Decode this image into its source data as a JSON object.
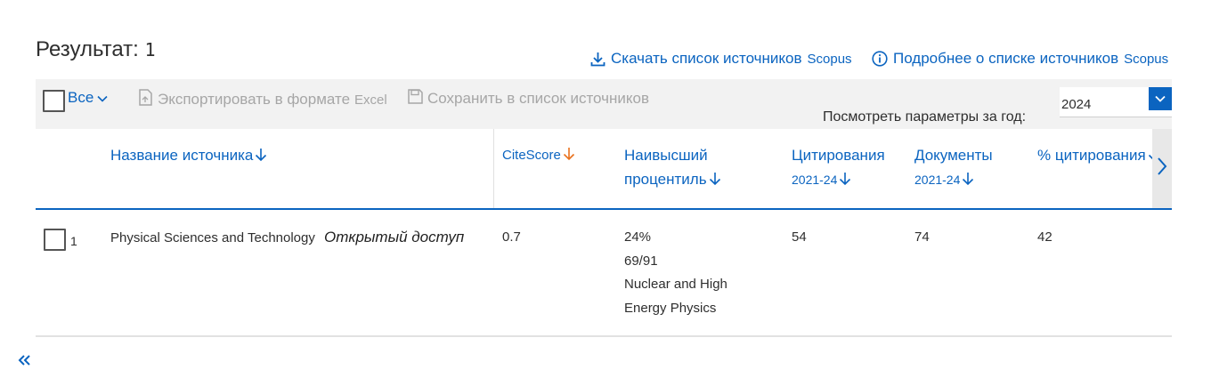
{
  "header": {
    "results_label": "Результат:",
    "results_count": "1",
    "download_link": {
      "text": "Скачать список источников",
      "suffix": "Scopus"
    },
    "info_link": {
      "text": "Подробнее о списке источников",
      "suffix": "Scopus"
    }
  },
  "toolbar": {
    "all_label": "Все",
    "export_label": "Экспортировать в формате",
    "export_suffix": "Excel",
    "save_label": "Сохранить в список источников",
    "year_label": "Посмотреть параметры за год:",
    "year_value": "2024"
  },
  "table": {
    "columns": {
      "source_title": "Название источника",
      "citescore": "CiteScore",
      "percentile_line1": "Наивысший",
      "percentile_line2": "процентиль",
      "citations": "Цитирования",
      "citations_range": "2021-24",
      "documents": "Документы",
      "documents_range": "2021-24",
      "percent_cited": "% цитирования"
    },
    "rows": [
      {
        "index": "1",
        "source_title": "Physical Sciences and Technology",
        "open_access": "Открытый доступ",
        "citescore": "0.7",
        "percentile": "24%",
        "rank": "69/91",
        "category_line1": "Nuclear and High",
        "category_line2": "Energy Physics",
        "citations": "54",
        "documents": "74",
        "percent_cited": "42"
      }
    ]
  },
  "colors": {
    "link": "#0b64c0",
    "sort_active": "#e9711c",
    "toolbar_bg": "#f2f2f2",
    "disabled": "#a6a6a6"
  }
}
